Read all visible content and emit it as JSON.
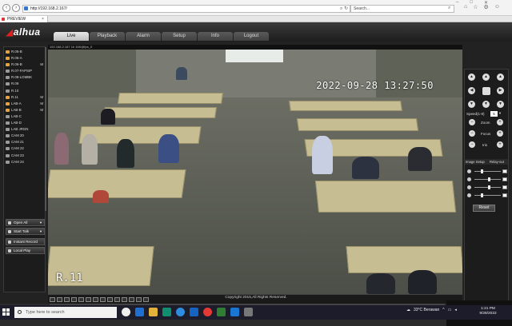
{
  "browser": {
    "address": "http://192.168.2.167/",
    "search_placeholder": "Search...",
    "tab_title": "PREVIEW",
    "tab_close": "×"
  },
  "app": {
    "logo": "alhua",
    "tabs": [
      "Live",
      "Playback",
      "Alarm",
      "Setup",
      "Info",
      "Logout"
    ],
    "active_tab": "Live"
  },
  "stream_info": "192.168.2.167 1h 16K@fps_0",
  "channels": [
    {
      "label": "R.05-B",
      "active": true,
      "badge": ""
    },
    {
      "label": "R.06-A",
      "active": true,
      "badge": ""
    },
    {
      "label": "R.06-B",
      "active": true,
      "badge": "M"
    },
    {
      "label": "R.07-FAPSIP",
      "active": false,
      "badge": ""
    },
    {
      "label": "R.08-LOMBK",
      "active": false,
      "badge": ""
    },
    {
      "label": "R.09",
      "active": false,
      "badge": ""
    },
    {
      "label": "R.10",
      "active": false,
      "badge": ""
    },
    {
      "label": "R.11",
      "active": true,
      "badge": "M"
    },
    {
      "label": "LAB-A",
      "active": true,
      "badge": "M"
    },
    {
      "label": "LAB-B",
      "active": true,
      "badge": "M"
    },
    {
      "label": "LAB-C",
      "active": false,
      "badge": ""
    },
    {
      "label": "LAB-D",
      "active": false,
      "badge": ""
    },
    {
      "label": "LAB JRGN",
      "active": false,
      "badge": ""
    },
    {
      "label": "CAM 20",
      "active": false,
      "badge": ""
    },
    {
      "label": "CAM 21",
      "active": false,
      "badge": ""
    },
    {
      "label": "CAM 22",
      "active": false,
      "badge": ""
    },
    {
      "label": "CAM 23",
      "active": false,
      "badge": ""
    },
    {
      "label": "CAM 24",
      "active": false,
      "badge": ""
    }
  ],
  "commands": {
    "open_all": "Open All",
    "start_talk": "Start Talk",
    "instant_record": "Instant Record",
    "local_play": "Local Play"
  },
  "osd": {
    "timestamp": "2022-09-28 13:27:50",
    "camera_name": "R.11"
  },
  "ptz": {
    "speed_label": "Speed(1-8)",
    "speed_value": "5",
    "zoom": "Zoom",
    "focus": "Focus",
    "iris": "Iris"
  },
  "image_setup": {
    "tab1": "Image Setup",
    "tab2": "Relay-out",
    "reset": "Reset",
    "levels": [
      0.25,
      0.55,
      0.55,
      0.25
    ]
  },
  "footer": {
    "copyright": "Copyright 2015,All Rights Reserved.",
    "user": "Yulia"
  },
  "taskbar": {
    "search_placeholder": "Type here to search",
    "weather": "33°C  Berawan",
    "time": "1:21 PM",
    "date": "9/28/2022"
  }
}
